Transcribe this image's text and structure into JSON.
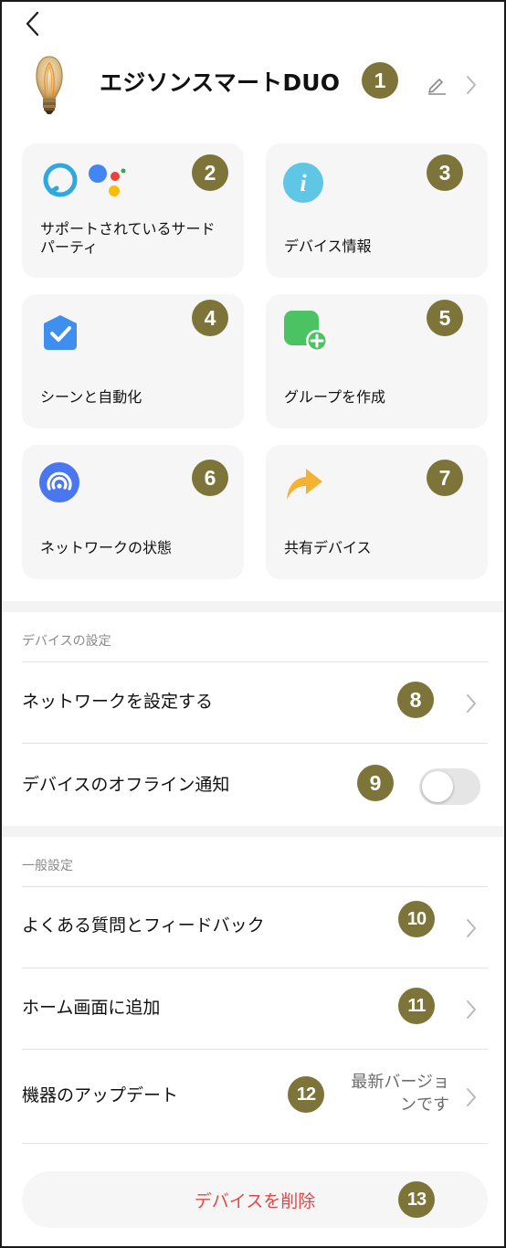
{
  "header": {
    "device_name": "エジソンスマートDUO"
  },
  "tiles": [
    {
      "label": "サポートされているサードパーティ",
      "badge": "2"
    },
    {
      "label": "デバイス情報",
      "badge": "3"
    },
    {
      "label": "シーンと自動化",
      "badge": "4"
    },
    {
      "label": "グループを作成",
      "badge": "5"
    },
    {
      "label": "ネットワークの状態",
      "badge": "6"
    },
    {
      "label": "共有デバイス",
      "badge": "7"
    }
  ],
  "badges": {
    "name": "1",
    "network": "8",
    "offline": "9",
    "faq": "10",
    "home": "11",
    "update": "12",
    "delete": "13"
  },
  "device_settings": {
    "section_title": "デバイスの設定",
    "network_label": "ネットワークを設定する",
    "offline_label": "デバイスのオフライン通知",
    "offline_enabled": false
  },
  "general_settings": {
    "section_title": "一般設定",
    "faq_label": "よくある質問とフィードバック",
    "home_label": "ホーム画面に追加",
    "update_label": "機器のアップデート",
    "update_value": "最新バージョンです"
  },
  "delete_label": "デバイスを削除",
  "colors": {
    "badge": "#7c7439",
    "card": "#f6f6f6",
    "danger": "#e64545",
    "alexa": "#2fa8e0",
    "info": "#5fc6e6",
    "scene": "#3f8ff0",
    "group": "#4cc363",
    "network": "#4a77ef",
    "share": "#f4b233"
  }
}
